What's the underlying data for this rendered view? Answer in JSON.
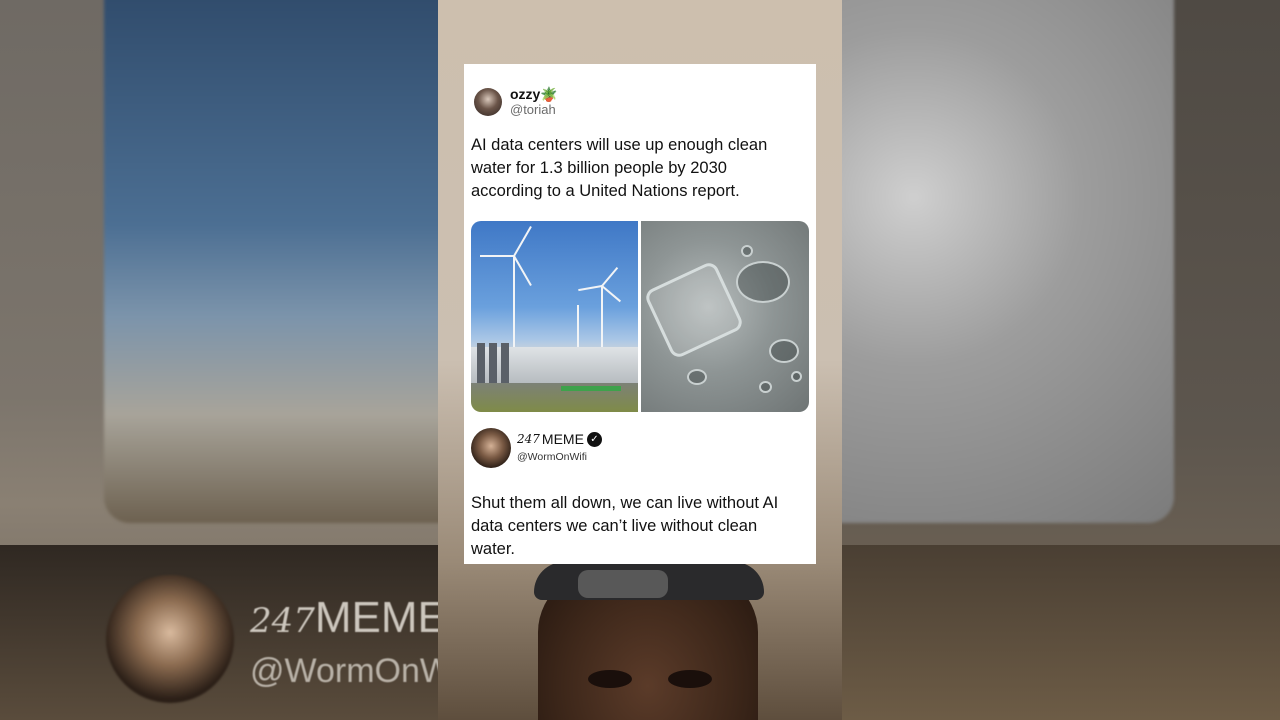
{
  "post": {
    "author_name": "ozzy",
    "author_emoji": "🪴",
    "author_handle": "@toriah",
    "text": "AI data centers will use up enough clean water for 1.3 billion people by 2030 according to a United Nations report.",
    "images": [
      "wind-turbines-data-center-photo",
      "spilled-water-glass-photo"
    ]
  },
  "reply": {
    "author_prefix": "247",
    "author_name": "MEME",
    "author_handle": "@WormOnWifi",
    "verified_icon": "verified-badge-icon",
    "verified_glyph": "✓",
    "text": "Shut them all down, we can live without AI data centers we can’t live without clean water."
  },
  "background": {
    "name_prefix": "247",
    "name": "MEME",
    "handle": "@WormOnWi"
  }
}
